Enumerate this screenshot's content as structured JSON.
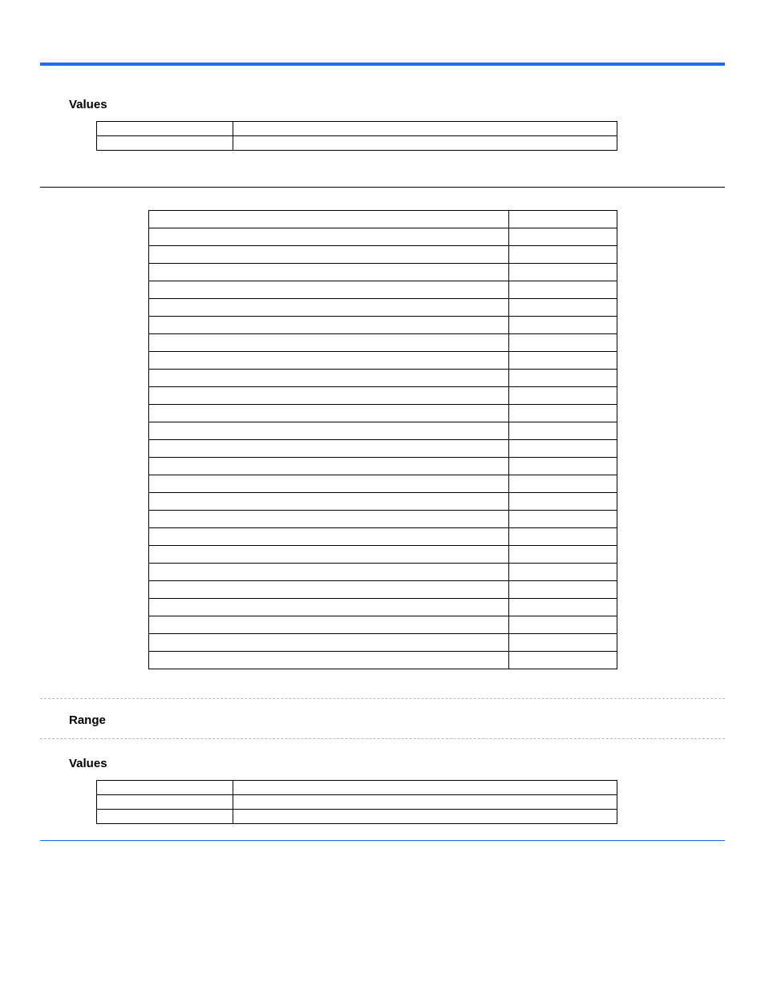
{
  "section1": {
    "heading": "Values",
    "rows": [
      {
        "a": "",
        "b": ""
      },
      {
        "a": "",
        "b": ""
      }
    ]
  },
  "bigTable": {
    "rows": [
      {
        "a": "",
        "b": ""
      },
      {
        "a": "",
        "b": ""
      },
      {
        "a": "",
        "b": ""
      },
      {
        "a": "",
        "b": ""
      },
      {
        "a": "",
        "b": ""
      },
      {
        "a": "",
        "b": ""
      },
      {
        "a": "",
        "b": ""
      },
      {
        "a": "",
        "b": ""
      },
      {
        "a": "",
        "b": ""
      },
      {
        "a": "",
        "b": ""
      },
      {
        "a": "",
        "b": ""
      },
      {
        "a": "",
        "b": ""
      },
      {
        "a": "",
        "b": ""
      },
      {
        "a": "",
        "b": ""
      },
      {
        "a": "",
        "b": ""
      },
      {
        "a": "",
        "b": ""
      },
      {
        "a": "",
        "b": ""
      },
      {
        "a": "",
        "b": ""
      },
      {
        "a": "",
        "b": ""
      },
      {
        "a": "",
        "b": ""
      },
      {
        "a": "",
        "b": ""
      },
      {
        "a": "",
        "b": ""
      },
      {
        "a": "",
        "b": ""
      },
      {
        "a": "",
        "b": ""
      },
      {
        "a": "",
        "b": ""
      },
      {
        "a": "",
        "b": ""
      }
    ]
  },
  "range": {
    "heading": "Range"
  },
  "section2": {
    "heading": "Values",
    "rows": [
      {
        "a": "",
        "b": ""
      },
      {
        "a": "",
        "b": ""
      },
      {
        "a": "",
        "b": ""
      }
    ]
  }
}
